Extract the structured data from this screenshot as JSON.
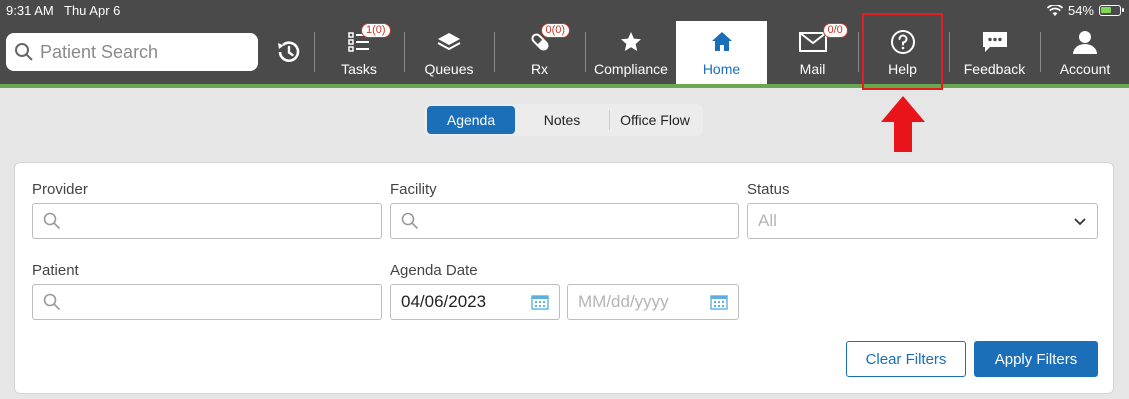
{
  "status": {
    "time": "9:31 AM",
    "date": "Thu Apr 6",
    "battery": "54%"
  },
  "search": {
    "placeholder": "Patient Search"
  },
  "nav": {
    "tasks": {
      "label": "Tasks",
      "badge": "1(0)"
    },
    "queues": {
      "label": "Queues"
    },
    "rx": {
      "label": "Rx",
      "badge": "0(0)"
    },
    "compliance": {
      "label": "Compliance"
    },
    "home": {
      "label": "Home"
    },
    "mail": {
      "label": "Mail",
      "badge": "0/0"
    },
    "help": {
      "label": "Help"
    },
    "feedback": {
      "label": "Feedback"
    },
    "account": {
      "label": "Account"
    }
  },
  "tabs": {
    "agenda": "Agenda",
    "notes": "Notes",
    "office_flow": "Office Flow"
  },
  "filters": {
    "provider_label": "Provider",
    "facility_label": "Facility",
    "status_label": "Status",
    "status_value": "All",
    "patient_label": "Patient",
    "agenda_date_label": "Agenda Date",
    "date_from": "04/06/2023",
    "date_to_placeholder": "MM/dd/yyyy",
    "clear_label": "Clear Filters",
    "apply_label": "Apply Filters"
  },
  "colors": {
    "accent": "#1a6fb8",
    "topbar": "#4a4a4a",
    "green": "#6aa84f",
    "highlight": "#e02020"
  }
}
